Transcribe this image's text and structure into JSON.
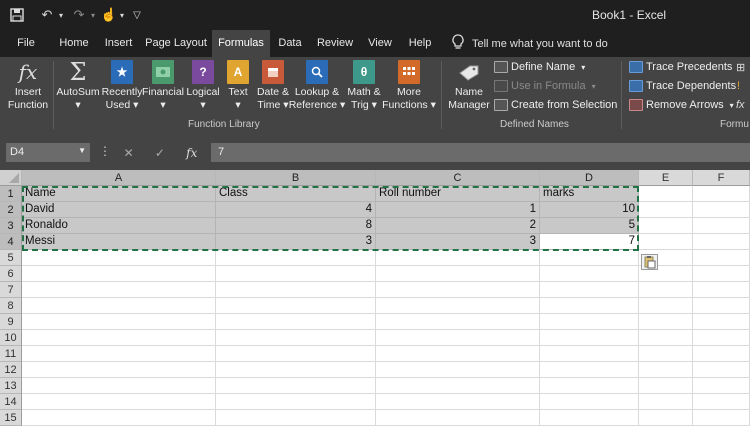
{
  "title": "Book1  -  Excel",
  "qat": {
    "undo": "↶",
    "redo": "↷",
    "touch": "☝",
    "customize": "▽"
  },
  "tabs": [
    {
      "label": "File"
    },
    {
      "label": "Home"
    },
    {
      "label": "Insert"
    },
    {
      "label": "Page Layout"
    },
    {
      "label": "Formulas",
      "active": true
    },
    {
      "label": "Data"
    },
    {
      "label": "Review"
    },
    {
      "label": "View"
    },
    {
      "label": "Help"
    }
  ],
  "tellme": "Tell me what you want to do",
  "ribbon": {
    "insert_function": {
      "l1": "Insert",
      "l2": "Function",
      "glyph": "fx"
    },
    "autosum": {
      "l1": "AutoSum",
      "dd": "▾",
      "glyph": "Σ"
    },
    "recently_used": {
      "l1": "Recently",
      "l2": "Used ▾",
      "glyph": "★",
      "color": "#2b6cb8"
    },
    "financial": {
      "l1": "Financial",
      "l2": "▾",
      "glyph": "",
      "color": "#4a9a6e"
    },
    "logical": {
      "l1": "Logical",
      "l2": "▾",
      "glyph": "?",
      "color": "#7a4a9e"
    },
    "text": {
      "l1": "Text",
      "l2": "▾",
      "glyph": "A",
      "color": "#e0a430"
    },
    "date_time": {
      "l1": "Date &",
      "l2": "Time ▾",
      "glyph": "",
      "color": "#c85a3a"
    },
    "lookup": {
      "l1": "Lookup &",
      "l2": "Reference ▾",
      "glyph": "",
      "color": "#2b6cb8"
    },
    "math_trig": {
      "l1": "Math &",
      "l2": "Trig ▾",
      "glyph": "θ",
      "color": "#3d9a8a"
    },
    "more_functions": {
      "l1": "More",
      "l2": "Functions ▾",
      "glyph": "",
      "color": "#d46a2a"
    },
    "function_library_label": "Function Library",
    "name_manager": {
      "l1": "Name",
      "l2": "Manager"
    },
    "define_name": "Define Name",
    "use_in_formula": "Use in Formula",
    "create_from_selection": "Create from Selection",
    "defined_names_label": "Defined Names",
    "trace_precedents": "Trace Precedents",
    "trace_dependents": "Trace Dependents",
    "remove_arrows": "Remove Arrows",
    "formula_auditing_label": "Formu"
  },
  "namebox": "D4",
  "formula_bar": {
    "cancel": "✕",
    "enter": "✓",
    "fx": "fx",
    "value": "7"
  },
  "columns": [
    "A",
    "B",
    "C",
    "D",
    "E",
    "F"
  ],
  "rows": [
    "1",
    "2",
    "3",
    "4",
    "5",
    "6",
    "7",
    "8",
    "9",
    "10",
    "11",
    "12",
    "13",
    "14",
    "15"
  ],
  "cells": [
    [
      "Name",
      "Class",
      "Roll number",
      "marks"
    ],
    [
      "David",
      "4",
      "1",
      "10"
    ],
    [
      "Ronaldo",
      "8",
      "2",
      "5"
    ],
    [
      "Messi",
      "3",
      "3",
      "7"
    ]
  ]
}
